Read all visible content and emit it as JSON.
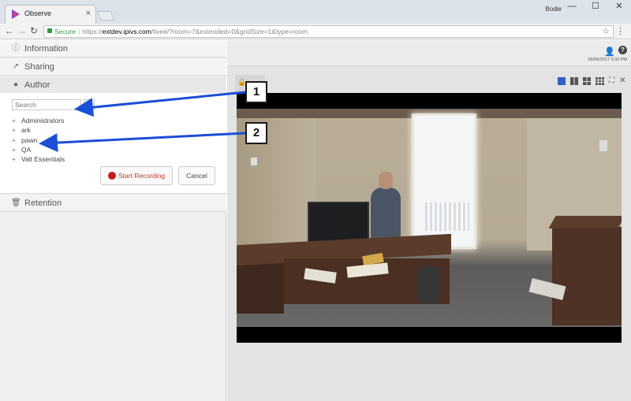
{
  "browser": {
    "tab_title": "Observe",
    "tab_close": "×",
    "user": "Bodie",
    "window_minimize": "—",
    "window_maximize": "☐",
    "window_close": "✕",
    "secure_label": "Secure",
    "url_scheme": "https://",
    "url_host": "extdev.ipivs.com",
    "url_path": "/live#/?room=7&extended=0&gridSize=1&type=room",
    "back_icon": "←",
    "forward_icon": "→",
    "reload_icon": "↻",
    "star_icon": "☆",
    "menu_icon": "⋮"
  },
  "sidebar": {
    "sections": {
      "information": {
        "label": "Information",
        "icon": "ⓘ"
      },
      "sharing": {
        "label": "Sharing",
        "icon": "↗"
      },
      "author": {
        "label": "Author",
        "icon": "●"
      },
      "retention": {
        "label": "Retention",
        "icon": "🗑"
      }
    },
    "search_placeholder": "Search",
    "search_add_icon": "+",
    "groups": [
      {
        "plus": "+",
        "label": "Administrators"
      },
      {
        "plus": "+",
        "label": "ark"
      },
      {
        "plus": "+",
        "label": "pawn"
      },
      {
        "plus": "+",
        "label": "QA"
      },
      {
        "plus": "+",
        "label": "Valt Essentials"
      }
    ],
    "start_recording_label": "Start Recording",
    "cancel_label": "Cancel"
  },
  "viewer": {
    "datetime": "09/06/2017 3:32 PM",
    "user_icon": "👤",
    "help_icon": "?",
    "lock_icon": "🔒",
    "fullscreen_icon": "⛶",
    "close_icon": "✕"
  },
  "annotations": [
    {
      "number": "1"
    },
    {
      "number": "2"
    }
  ],
  "colors": {
    "annotation_arrow": "#1a4fd6",
    "record_dot": "#c71d1d",
    "active_layout": "#2f5fc7",
    "secure_green": "#2e9b3d"
  }
}
